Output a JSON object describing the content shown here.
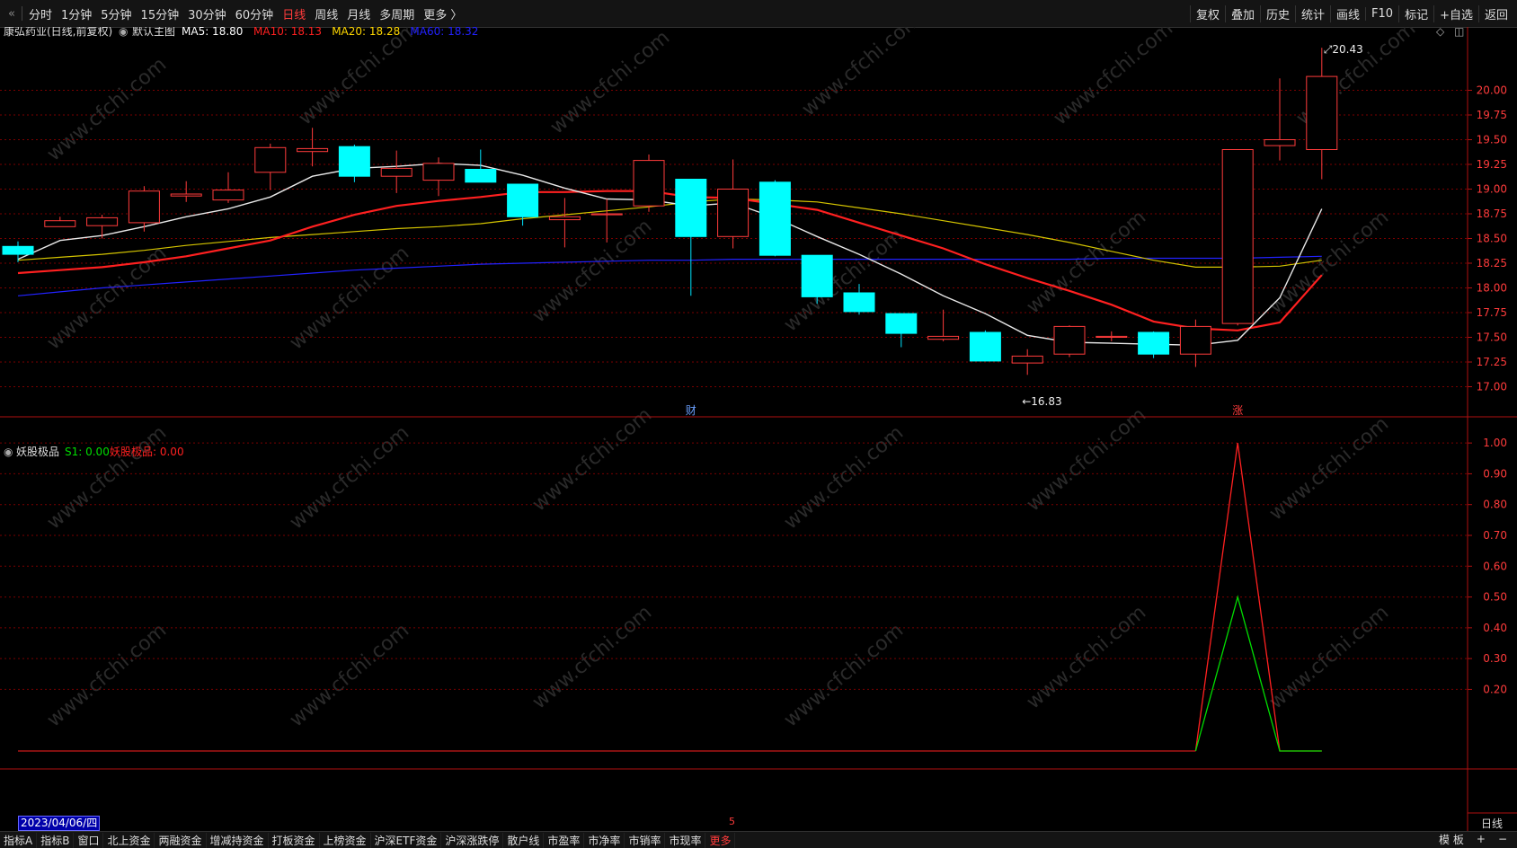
{
  "toolbar": {
    "periods": [
      "分时",
      "1分钟",
      "5分钟",
      "15分钟",
      "30分钟",
      "60分钟",
      "日线",
      "周线",
      "月线",
      "多周期",
      "更多 〉"
    ],
    "active_period": "日线",
    "right_items": [
      "复权",
      "叠加",
      "历史",
      "统计",
      "画线",
      "F10",
      "标记",
      "+自选",
      "返回"
    ]
  },
  "main_chart": {
    "stock_title": "康弘药业(日线,前复权)",
    "template_label": "默认主图",
    "ma_labels": [
      {
        "text": "MA5: 18.80",
        "color": "#ffffff"
      },
      {
        "text": "MA10: 18.13",
        "color": "#ff2020"
      },
      {
        "text": "MA20: 18.28",
        "color": "#ffd700"
      },
      {
        "text": "MA60: 18.32",
        "color": "#2222ff"
      }
    ],
    "max_label": "20.43",
    "min_label": "16.83",
    "event_marks": [
      "财",
      "涨"
    ]
  },
  "indicator": {
    "name": "妖股极品",
    "s1_label": "S1: 0.00",
    "value_label": "妖股极品: 0.00"
  },
  "date_label": "2023/04/06/四",
  "axis_mark": "5",
  "period_footer": "日线",
  "bottom_tabs": [
    "指标A",
    "指标B",
    "窗口",
    "北上资金",
    "两融资金",
    "增减持资金",
    "打板资金",
    "上榜资金",
    "沪深ETF资金",
    "沪深涨跌停",
    "散户线",
    "市盈率",
    "市净率",
    "市销率",
    "市现率",
    "更多"
  ],
  "bottom_right": [
    "模 板",
    "+",
    "−"
  ],
  "watermark": "www.cfchi.com",
  "chart_data": {
    "type": "candlestick",
    "price_axis": {
      "ticks": [
        "17.00",
        "17.25",
        "17.50",
        "17.75",
        "18.00",
        "18.25",
        "18.50",
        "18.75",
        "19.00",
        "19.25",
        "19.50",
        "19.75",
        "20.00"
      ],
      "range": [
        16.75,
        20.55
      ]
    },
    "indicator_axis": {
      "ticks": [
        "0.20",
        "0.30",
        "0.40",
        "0.50",
        "0.60",
        "0.70",
        "0.80",
        "0.90",
        "1.00"
      ],
      "range": [
        0,
        1.05
      ]
    },
    "candles": [
      {
        "o": 18.34,
        "h": 18.47,
        "l": 18.26,
        "c": 18.42,
        "up": false
      },
      {
        "o": 18.68,
        "h": 18.72,
        "l": 18.66,
        "c": 18.62,
        "up": true
      },
      {
        "o": 18.63,
        "h": 18.74,
        "l": 18.5,
        "c": 18.71,
        "up": true
      },
      {
        "o": 18.66,
        "h": 19.03,
        "l": 18.57,
        "c": 18.98,
        "up": true
      },
      {
        "o": 18.93,
        "h": 19.08,
        "l": 18.87,
        "c": 18.95,
        "up": true
      },
      {
        "o": 18.89,
        "h": 19.17,
        "l": 18.86,
        "c": 18.99,
        "up": true
      },
      {
        "o": 19.17,
        "h": 19.46,
        "l": 18.99,
        "c": 19.42,
        "up": true
      },
      {
        "o": 19.38,
        "h": 19.62,
        "l": 19.23,
        "c": 19.41,
        "up": true
      },
      {
        "o": 19.43,
        "h": 19.45,
        "l": 19.07,
        "c": 19.13,
        "up": false
      },
      {
        "o": 19.13,
        "h": 19.39,
        "l": 18.96,
        "c": 19.21,
        "up": true
      },
      {
        "o": 19.09,
        "h": 19.32,
        "l": 18.93,
        "c": 19.26,
        "up": true
      },
      {
        "o": 19.2,
        "h": 19.4,
        "l": 19.07,
        "c": 19.07,
        "up": false
      },
      {
        "o": 19.05,
        "h": 19.05,
        "l": 18.63,
        "c": 18.72,
        "up": false
      },
      {
        "o": 18.69,
        "h": 18.91,
        "l": 18.41,
        "c": 18.72,
        "up": true
      },
      {
        "o": 18.74,
        "h": 18.9,
        "l": 18.46,
        "c": 18.75,
        "up": true
      },
      {
        "o": 18.83,
        "h": 19.35,
        "l": 18.77,
        "c": 19.29,
        "up": true
      },
      {
        "o": 19.1,
        "h": 19.1,
        "l": 17.92,
        "c": 18.52,
        "up": false
      },
      {
        "o": 18.52,
        "h": 19.3,
        "l": 18.4,
        "c": 19.0,
        "up": true
      },
      {
        "o": 19.07,
        "h": 19.09,
        "l": 18.32,
        "c": 18.33,
        "up": false
      },
      {
        "o": 18.33,
        "h": 18.33,
        "l": 17.84,
        "c": 17.91,
        "up": false
      },
      {
        "o": 17.95,
        "h": 18.04,
        "l": 17.73,
        "c": 17.76,
        "up": false
      },
      {
        "o": 17.74,
        "h": 17.74,
        "l": 17.4,
        "c": 17.54,
        "up": false
      },
      {
        "o": 17.48,
        "h": 17.78,
        "l": 17.46,
        "c": 17.51,
        "up": true
      },
      {
        "o": 17.55,
        "h": 17.57,
        "l": 17.26,
        "c": 17.26,
        "up": false
      },
      {
        "o": 17.24,
        "h": 17.38,
        "l": 17.12,
        "c": 17.31,
        "up": true
      },
      {
        "o": 17.33,
        "h": 17.62,
        "l": 17.3,
        "c": 17.61,
        "up": true
      },
      {
        "o": 17.5,
        "h": 17.56,
        "l": 17.46,
        "c": 17.51,
        "up": true
      },
      {
        "o": 17.55,
        "h": 17.56,
        "l": 17.29,
        "c": 17.33,
        "up": false
      },
      {
        "o": 17.33,
        "h": 17.68,
        "l": 17.2,
        "c": 17.61,
        "up": true
      },
      {
        "o": 17.64,
        "h": 19.4,
        "l": 17.62,
        "c": 19.4,
        "up": true
      },
      {
        "o": 19.44,
        "h": 20.12,
        "l": 19.29,
        "c": 19.5,
        "up": true
      },
      {
        "o": 19.4,
        "h": 20.43,
        "l": 19.1,
        "c": 20.14,
        "up": true
      }
    ],
    "ma5": [
      18.29,
      18.48,
      18.53,
      18.62,
      18.72,
      18.8,
      18.92,
      19.13,
      19.21,
      19.23,
      19.26,
      19.24,
      19.14,
      19.01,
      18.9,
      18.89,
      18.83,
      18.86,
      18.71,
      18.52,
      18.34,
      18.14,
      17.92,
      17.74,
      17.52,
      17.45,
      17.44,
      17.43,
      17.42,
      17.47,
      17.9,
      18.8
    ],
    "ma10": [
      18.15,
      18.18,
      18.21,
      18.26,
      18.32,
      18.4,
      18.48,
      18.62,
      18.74,
      18.83,
      18.88,
      18.92,
      18.97,
      18.97,
      18.98,
      18.98,
      18.92,
      18.91,
      18.85,
      18.79,
      18.66,
      18.53,
      18.4,
      18.24,
      18.1,
      17.97,
      17.83,
      17.66,
      17.59,
      17.57,
      17.65,
      18.13
    ],
    "ma20": [
      18.28,
      18.31,
      18.34,
      18.38,
      18.43,
      18.47,
      18.51,
      18.54,
      18.57,
      18.6,
      18.62,
      18.65,
      18.7,
      18.74,
      18.78,
      18.82,
      18.87,
      18.9,
      18.89,
      18.87,
      18.81,
      18.75,
      18.68,
      18.61,
      18.54,
      18.46,
      18.37,
      18.28,
      18.21,
      18.21,
      18.22,
      18.28
    ],
    "ma60": [
      17.92,
      17.96,
      18.0,
      18.03,
      18.06,
      18.09,
      18.12,
      18.15,
      18.18,
      18.2,
      18.22,
      18.24,
      18.25,
      18.26,
      18.27,
      18.28,
      18.28,
      18.29,
      18.29,
      18.29,
      18.29,
      18.29,
      18.29,
      18.29,
      18.29,
      18.29,
      18.3,
      18.3,
      18.3,
      18.3,
      18.31,
      18.32
    ],
    "indicator_series": [
      {
        "name": "S1",
        "color": "#00dd00",
        "values": [
          0,
          0,
          0,
          0,
          0,
          0,
          0,
          0,
          0,
          0,
          0,
          0,
          0,
          0,
          0,
          0,
          0,
          0,
          0,
          0,
          0,
          0,
          0,
          0,
          0,
          0,
          0,
          0,
          0,
          0.5,
          0,
          0
        ]
      },
      {
        "name": "妖股极品",
        "color": "#ff2020",
        "values": [
          0,
          0,
          0,
          0,
          0,
          0,
          0,
          0,
          0,
          0,
          0,
          0,
          0,
          0,
          0,
          0,
          0,
          0,
          0,
          0,
          0,
          0,
          0,
          0,
          0,
          0,
          0,
          0,
          0,
          1.0,
          0,
          0
        ]
      }
    ]
  }
}
